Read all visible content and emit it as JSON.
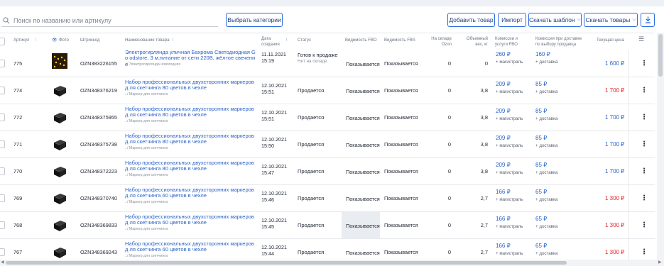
{
  "search": {
    "placeholder": "Поиск по названию или артикулу"
  },
  "toolbar": {
    "categories": "Выбрать категории",
    "add_product": "Добавить товар",
    "import": "Импорт",
    "download_template": "Скачать шаблон",
    "download_products": "Скачать товары"
  },
  "headers": {
    "article": "Артикул",
    "photo": "Фото",
    "barcode": "Штрихкод",
    "name": "Наименование товара",
    "date": "Дата создания",
    "status": "Статус",
    "fbo_visibility": "Видимость FBO",
    "fbs_visibility": "Видимость FBS",
    "ozon_stock": "На складе Ozon",
    "volume_weight": "Объемный вес, кг",
    "fbo_commission": "Комиссии и услуги FBO",
    "fbs_commission": "Комиссия при доставке по выбору продавца",
    "current_price": "Текущая цена"
  },
  "rows": [
    {
      "article": "775",
      "barcode": "OZN383226155",
      "name": "Электрогирлянда уличная Бахрома Светодиодная Go odstore, 3 м,питание от сети 220В, жёлтое свечение",
      "path": "../ Электрогирлянда новогодняя",
      "date": "11.11.2021",
      "time": "15:19",
      "status": "Готов к продаже",
      "status_sub": "Нет на складе",
      "fbo": "Показывается",
      "fbs": "Показывается",
      "stock": "0",
      "weight": "0",
      "fbo_comm": "260 ₽",
      "fbo_sub": "+ магистраль",
      "fbs_comm": "160 ₽",
      "fbs_sub": "+ доставка",
      "price": "1 600 ₽",
      "price_color": "#2a63c9",
      "thumb": "garland"
    },
    {
      "article": "774",
      "barcode": "OZN348376219",
      "name": "Набор профессиональных двухсторонних маркеров д ля скетчинга 80 цветов в чехле",
      "path": "../ Маркер для скетчинга",
      "date": "12.10.2021",
      "time": "15:51",
      "status": "Продается",
      "status_sub": "",
      "fbo": "Показывается",
      "fbs": "Показывается",
      "stock": "0",
      "weight": "3,8",
      "fbo_comm": "209 ₽",
      "fbo_sub": "+ магистраль",
      "fbs_comm": "85 ₽",
      "fbs_sub": "+ доставка",
      "price": "1 700 ₽",
      "price_color": "#e5252c",
      "thumb": "case"
    },
    {
      "article": "772",
      "barcode": "OZN348375955",
      "name": "Набор профессиональных двухсторонних маркеров д ля скетчинга 80 цветов в чехле",
      "path": "../ Маркер для скетчинга",
      "date": "12.10.2021",
      "time": "15:51",
      "status": "Продается",
      "status_sub": "",
      "fbo": "Показывается",
      "fbs": "Показывается",
      "stock": "0",
      "weight": "3,8",
      "fbo_comm": "209 ₽",
      "fbo_sub": "+ магистраль",
      "fbs_comm": "85 ₽",
      "fbs_sub": "+ доставка",
      "price": "1 700 ₽",
      "price_color": "#2a63c9",
      "thumb": "case"
    },
    {
      "article": "771",
      "barcode": "OZN348375738",
      "name": "Набор профессиональных двухсторонних маркеров д ля скетчинга 80 цветов в чехле",
      "path": "../ Маркер для скетчинга",
      "date": "12.10.2021",
      "time": "15:50",
      "status": "Продается",
      "status_sub": "",
      "fbo": "Показывается",
      "fbs": "Показывается",
      "stock": "0",
      "weight": "3,8",
      "fbo_comm": "209 ₽",
      "fbo_sub": "+ магистраль",
      "fbs_comm": "85 ₽",
      "fbs_sub": "+ доставка",
      "price": "1 700 ₽",
      "price_color": "#2a63c9",
      "thumb": "case"
    },
    {
      "article": "770",
      "barcode": "OZN348372223",
      "name": "Набор профессиональных двухсторонних маркеров д ля скетчинга 80 цветов в чехле",
      "path": "../ Маркер для скетчинга",
      "date": "12.10.2021",
      "time": "15:47",
      "status": "Продается",
      "status_sub": "",
      "fbo": "Показывается",
      "fbs": "Показывается",
      "stock": "0",
      "weight": "3,8",
      "fbo_comm": "209 ₽",
      "fbo_sub": "+ магистраль",
      "fbs_comm": "85 ₽",
      "fbs_sub": "+ доставка",
      "price": "1 700 ₽",
      "price_color": "#2a63c9",
      "thumb": "case"
    },
    {
      "article": "769",
      "barcode": "OZN348370740",
      "name": "Набор профессиональных двухсторонних маркеров д ля скетчинга 60 цветов в чехле",
      "path": "../ Маркер для скетчинга",
      "date": "12.10.2021",
      "time": "15:46",
      "status": "Продается",
      "status_sub": "",
      "fbo": "Показывается",
      "fbs": "Показывается",
      "stock": "0",
      "weight": "2,7",
      "fbo_comm": "166 ₽",
      "fbo_sub": "+ магистраль",
      "fbs_comm": "65 ₽",
      "fbs_sub": "+ доставка",
      "price": "1 300 ₽",
      "price_color": "#e5252c",
      "thumb": "case"
    },
    {
      "article": "768",
      "barcode": "OZN348369833",
      "name": "Набор профессиональных двухсторонних маркеров д ля скетчинга 60 цветов в чехле",
      "path": "../ Маркер для скетчинга",
      "date": "12.10.2021",
      "time": "15:45",
      "status": "Продается",
      "status_sub": "",
      "fbo": "Показывается",
      "fbs": "Показывается",
      "stock": "0",
      "weight": "2,7",
      "fbo_comm": "166 ₽",
      "fbo_sub": "+ магистраль",
      "fbs_comm": "65 ₽",
      "fbs_sub": "+ доставка",
      "price": "1 300 ₽",
      "price_color": "#e5252c",
      "thumb": "case",
      "highlight": true
    },
    {
      "article": "767",
      "barcode": "OZN348369243",
      "name": "Набор профессиональных двухсторонних маркеров д ля скетчинга 60 цветов в чехле",
      "path": "../ Маркер для скетчинга",
      "date": "12.10.2021",
      "time": "15:44",
      "status": "Продается",
      "status_sub": "",
      "fbo": "Показывается",
      "fbs": "Показывается",
      "stock": "0",
      "weight": "2,7",
      "fbo_comm": "166 ₽",
      "fbo_sub": "+ магистраль",
      "fbs_comm": "65 ₽",
      "fbs_sub": "+ доставка",
      "price": "1 300 ₽",
      "price_color": "#e5252c",
      "thumb": "case"
    }
  ]
}
